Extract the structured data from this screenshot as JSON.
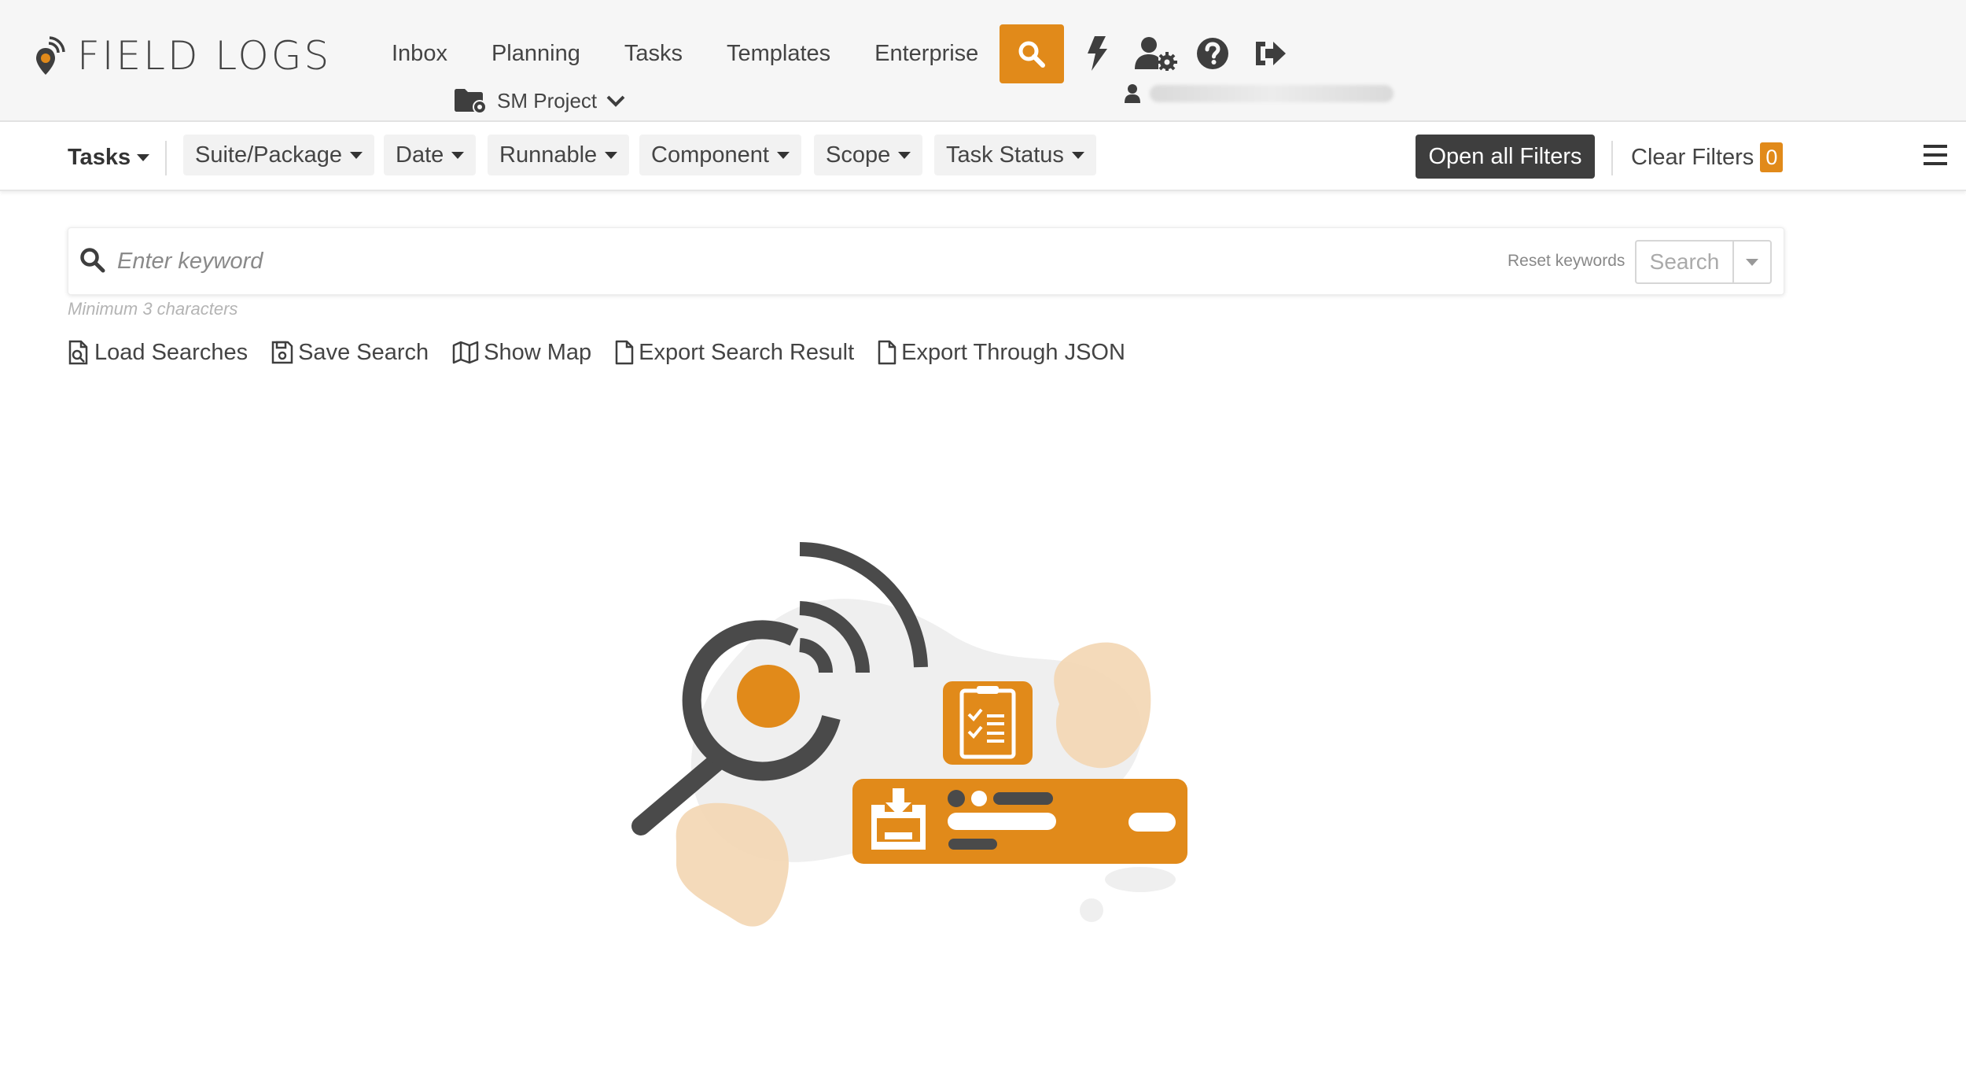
{
  "brand": {
    "name": "FIELD LOGS"
  },
  "nav": {
    "items": [
      {
        "label": "Inbox"
      },
      {
        "label": "Planning"
      },
      {
        "label": "Tasks"
      },
      {
        "label": "Templates"
      },
      {
        "label": "Enterprise"
      }
    ],
    "icons": [
      "search-icon",
      "bolt-icon",
      "user-settings-icon",
      "help-icon",
      "logout-icon"
    ]
  },
  "project": {
    "label": "SM Project"
  },
  "filters": {
    "scope_label": "Tasks",
    "pills": [
      {
        "label": "Suite/Package"
      },
      {
        "label": "Date"
      },
      {
        "label": "Runnable"
      },
      {
        "label": "Component"
      },
      {
        "label": "Scope"
      },
      {
        "label": "Task Status"
      }
    ],
    "open_all_label": "Open all Filters",
    "clear_label": "Clear Filters",
    "clear_count": "0"
  },
  "search": {
    "placeholder": "Enter keyword",
    "reset_label": "Reset keywords",
    "submit_label": "Search",
    "hint": "Minimum 3 characters"
  },
  "actions": [
    {
      "label": "Load Searches",
      "icon": "file-search-icon"
    },
    {
      "label": "Save Search",
      "icon": "floppy-disk-icon"
    },
    {
      "label": "Show Map",
      "icon": "map-icon"
    },
    {
      "label": "Export Search Result",
      "icon": "file-icon"
    },
    {
      "label": "Export Through JSON",
      "icon": "file-icon"
    }
  ],
  "colors": {
    "accent": "#e18a1a",
    "dark": "#3e3e3e",
    "header_bg": "#f6f6f6",
    "blob_light": "#f3d6b3"
  }
}
